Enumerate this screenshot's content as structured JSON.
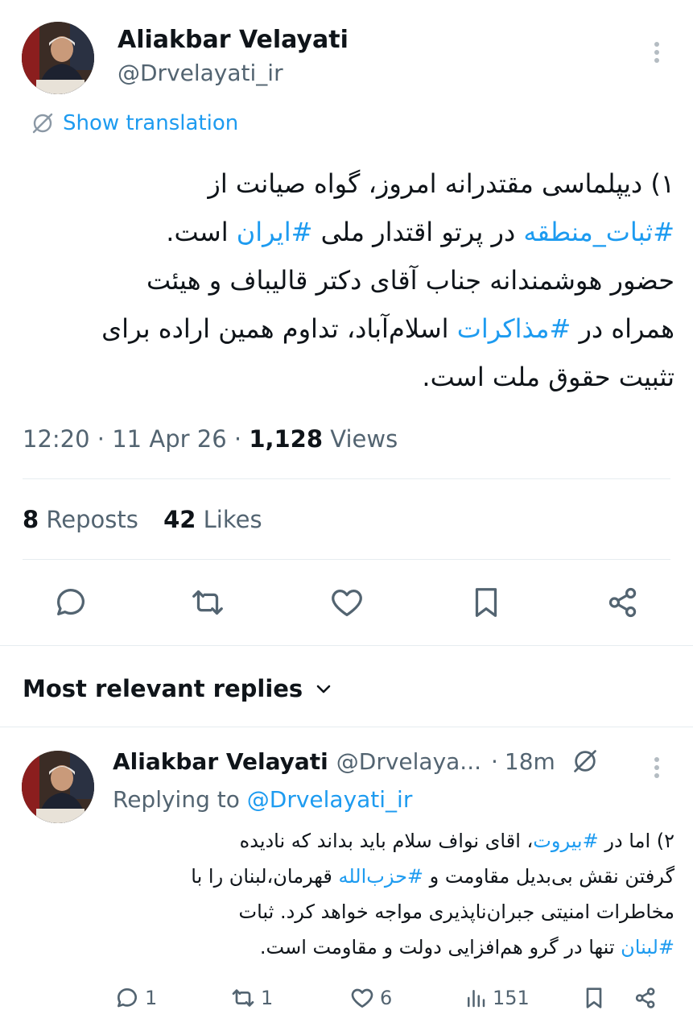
{
  "tweet": {
    "author_name": "Aliakbar Velayati",
    "author_handle": "@Drvelayati_ir",
    "show_translation": "Show translation",
    "text_lines": [
      "۱) دیپلماسی مقتدرانه امروز، گواه صیانت از",
      "است. #ایران در پرتو اقتدار ملی #ثبات_منطقه",
      "حضور هوشمندانه جناب آقای دکتر قالیباف و هیئت",
      "همراه در #مذاکرات اسلام‌آباد، تداوم همین اراده برای",
      "تثبیت حقوق ملت است."
    ],
    "line2": {
      "hashtag1": "#ثبات_منطقه",
      "middle": " در پرتو اقتدار ملی ",
      "hashtag2": "#ایران",
      "end": " است."
    },
    "line4": {
      "start": "همراه در ",
      "hashtag": "#مذاکرات",
      "end": " اسلام‌آباد، تداوم همین اراده برای"
    },
    "time": "12:20",
    "date": "11 Apr 26",
    "views_count": "1,128",
    "views_label": "Views",
    "reposts_count": "8",
    "reposts_label": "Reposts",
    "likes_count": "42",
    "likes_label": "Likes"
  },
  "replies_header": {
    "label": "Most relevant replies"
  },
  "reply": {
    "author_name": "Aliakbar Velayati",
    "author_handle": "@Drvelaya...",
    "time_ago": "18m",
    "replying_to_label": "Replying to",
    "replying_to_handle": "@Drvelayati_ir",
    "line1": {
      "start": "۲)  اما در ",
      "hashtag": "#بیروت",
      "end": "، اقای نواف سلام باید بداند که نادیده"
    },
    "line2": {
      "start": "گرفتن نقش بی‌بدیل مقاومت و ",
      "hashtag": "#حزب‌الله",
      "end": " قهرمان،لبنان را با"
    },
    "line3": "مخاطرات امنیتی جبران‌ناپذیری مواجه خواهد کرد. ثبات",
    "line4": {
      "hashtag": "#لبنان",
      "end": "  تنها در گرو هم‌افزایی دولت و مقاومت است."
    },
    "reply_count": "1",
    "repost_count": "1",
    "like_count": "6",
    "views_count": "151"
  },
  "colors": {
    "link": "#1d9bf0",
    "muted": "#536471",
    "text": "#0f1419"
  }
}
